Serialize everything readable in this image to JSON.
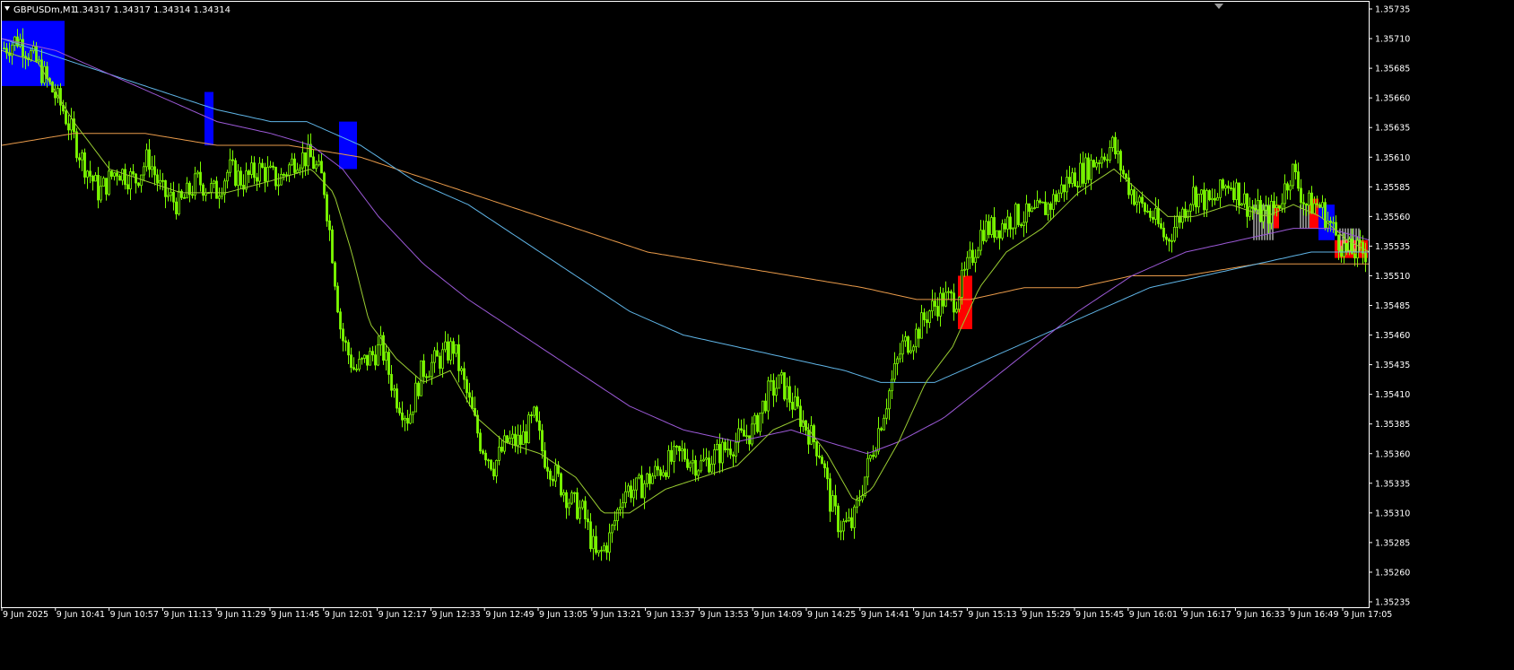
{
  "header": {
    "symbol_timeframe": "GBPUSDm,M1",
    "ohlc": "1.34317 1.34317 1.34314 1.34314",
    "menu_icon": "triangle-down-icon",
    "shift_marker_icon": "triangle-down-icon"
  },
  "colors": {
    "background": "#000000",
    "frame": "#ffffff",
    "candle": "#7cfc00",
    "ma_fast": "#9acd32",
    "ma_purple": "#9b59d6",
    "ma_blue": "#5fb4e6",
    "ma_orange": "#e89a4a",
    "band_blue": "#0000ff",
    "band_red": "#ff0000",
    "band_white": "#ffffff"
  },
  "chart_data": {
    "type": "candlestick",
    "y_ticks": [
      "1.35735",
      "1.35710",
      "1.35685",
      "1.35660",
      "1.35635",
      "1.35610",
      "1.35585",
      "1.35560",
      "1.35535",
      "1.35510",
      "1.35485",
      "1.35460",
      "1.35435",
      "1.35410",
      "1.35385",
      "1.35360",
      "1.35335",
      "1.35310",
      "1.35285",
      "1.35260",
      "1.35235"
    ],
    "x_ticks": [
      "9 Jun 2025",
      "9 Jun 10:41",
      "9 Jun 10:57",
      "9 Jun 11:13",
      "9 Jun 11:29",
      "9 Jun 11:45",
      "9 Jun 12:01",
      "9 Jun 12:17",
      "9 Jun 12:33",
      "9 Jun 12:49",
      "9 Jun 13:05",
      "9 Jun 13:21",
      "9 Jun 13:37",
      "9 Jun 13:53",
      "9 Jun 14:09",
      "9 Jun 14:25",
      "9 Jun 14:41",
      "9 Jun 14:57",
      "9 Jun 15:13",
      "9 Jun 15:29",
      "9 Jun 15:45",
      "9 Jun 16:01",
      "9 Jun 16:17",
      "9 Jun 16:33",
      "9 Jun 16:49",
      "9 Jun 17:05"
    ],
    "ylim": [
      1.3523,
      1.3574
    ],
    "price_path": [
      [
        0,
        1.357
      ],
      [
        20,
        1.3571
      ],
      [
        40,
        1.3569
      ],
      [
        55,
        1.3567
      ],
      [
        70,
        1.3565
      ],
      [
        90,
        1.3561
      ],
      [
        110,
        1.3558
      ],
      [
        130,
        1.356
      ],
      [
        150,
        1.3559
      ],
      [
        165,
        1.3561
      ],
      [
        180,
        1.3558
      ],
      [
        200,
        1.3557
      ],
      [
        220,
        1.3559
      ],
      [
        240,
        1.3558
      ],
      [
        255,
        1.356
      ],
      [
        270,
        1.3559
      ],
      [
        290,
        1.356
      ],
      [
        310,
        1.3559
      ],
      [
        330,
        1.3561
      ],
      [
        345,
        1.3561
      ],
      [
        360,
        1.3559
      ],
      [
        370,
        1.3553
      ],
      [
        380,
        1.3546
      ],
      [
        395,
        1.3543
      ],
      [
        410,
        1.3544
      ],
      [
        425,
        1.3545
      ],
      [
        440,
        1.3541
      ],
      [
        455,
        1.3539
      ],
      [
        470,
        1.3543
      ],
      [
        490,
        1.3544
      ],
      [
        505,
        1.3545
      ],
      [
        520,
        1.3541
      ],
      [
        535,
        1.3537
      ],
      [
        550,
        1.3535
      ],
      [
        565,
        1.3537
      ],
      [
        580,
        1.3537
      ],
      [
        595,
        1.3539
      ],
      [
        605,
        1.3536
      ],
      [
        620,
        1.3534
      ],
      [
        635,
        1.3532
      ],
      [
        650,
        1.3531
      ],
      [
        665,
        1.3527
      ],
      [
        680,
        1.3529
      ],
      [
        695,
        1.3533
      ],
      [
        710,
        1.3533
      ],
      [
        725,
        1.3534
      ],
      [
        740,
        1.3535
      ],
      [
        760,
        1.3536
      ],
      [
        780,
        1.3535
      ],
      [
        800,
        1.3536
      ],
      [
        820,
        1.3537
      ],
      [
        840,
        1.3538
      ],
      [
        855,
        1.3541
      ],
      [
        870,
        1.3542
      ],
      [
        885,
        1.354
      ],
      [
        900,
        1.3538
      ],
      [
        915,
        1.3536
      ],
      [
        925,
        1.3532
      ],
      [
        935,
        1.353
      ],
      [
        950,
        1.353
      ],
      [
        960,
        1.3533
      ],
      [
        975,
        1.3537
      ],
      [
        990,
        1.3541
      ],
      [
        1005,
        1.3545
      ],
      [
        1020,
        1.3546
      ],
      [
        1035,
        1.3548
      ],
      [
        1050,
        1.3549
      ],
      [
        1065,
        1.3549
      ],
      [
        1080,
        1.3552
      ],
      [
        1095,
        1.3555
      ],
      [
        1110,
        1.3555
      ],
      [
        1130,
        1.3556
      ],
      [
        1150,
        1.3556
      ],
      [
        1170,
        1.3557
      ],
      [
        1190,
        1.3559
      ],
      [
        1210,
        1.356
      ],
      [
        1225,
        1.3561
      ],
      [
        1240,
        1.3562
      ],
      [
        1255,
        1.3559
      ],
      [
        1270,
        1.3557
      ],
      [
        1285,
        1.3556
      ],
      [
        1300,
        1.3554
      ],
      [
        1315,
        1.3556
      ],
      [
        1330,
        1.3558
      ],
      [
        1350,
        1.3557
      ],
      [
        1370,
        1.3559
      ],
      [
        1390,
        1.3557
      ],
      [
        1410,
        1.3556
      ],
      [
        1425,
        1.3557
      ],
      [
        1440,
        1.356
      ],
      [
        1455,
        1.3557
      ],
      [
        1470,
        1.3557
      ],
      [
        1485,
        1.3555
      ],
      [
        1500,
        1.3553
      ],
      [
        1515,
        1.3553
      ],
      [
        1525,
        1.3553
      ]
    ],
    "ma_fast": [
      [
        0,
        1.357
      ],
      [
        40,
        1.3569
      ],
      [
        80,
        1.3564
      ],
      [
        120,
        1.356
      ],
      [
        160,
        1.3559
      ],
      [
        200,
        1.3558
      ],
      [
        250,
        1.3558
      ],
      [
        300,
        1.3559
      ],
      [
        345,
        1.356
      ],
      [
        370,
        1.3558
      ],
      [
        390,
        1.3553
      ],
      [
        410,
        1.3547
      ],
      [
        440,
        1.3544
      ],
      [
        470,
        1.3542
      ],
      [
        500,
        1.3543
      ],
      [
        530,
        1.3539
      ],
      [
        560,
        1.3537
      ],
      [
        600,
        1.3536
      ],
      [
        640,
        1.3534
      ],
      [
        670,
        1.3531
      ],
      [
        700,
        1.3531
      ],
      [
        740,
        1.3533
      ],
      [
        780,
        1.3534
      ],
      [
        820,
        1.3535
      ],
      [
        860,
        1.3538
      ],
      [
        890,
        1.3539
      ],
      [
        920,
        1.3536
      ],
      [
        950,
        1.3532
      ],
      [
        970,
        1.3533
      ],
      [
        1000,
        1.3537
      ],
      [
        1030,
        1.3542
      ],
      [
        1060,
        1.3545
      ],
      [
        1090,
        1.355
      ],
      [
        1120,
        1.3553
      ],
      [
        1160,
        1.3555
      ],
      [
        1200,
        1.3558
      ],
      [
        1240,
        1.356
      ],
      [
        1270,
        1.3558
      ],
      [
        1300,
        1.3556
      ],
      [
        1330,
        1.3556
      ],
      [
        1370,
        1.3557
      ],
      [
        1410,
        1.3556
      ],
      [
        1440,
        1.3557
      ],
      [
        1470,
        1.3556
      ],
      [
        1500,
        1.3554
      ],
      [
        1525,
        1.3553
      ]
    ],
    "ma_purple": [
      [
        0,
        1.3571
      ],
      [
        60,
        1.357
      ],
      [
        120,
        1.3568
      ],
      [
        180,
        1.3566
      ],
      [
        240,
        1.3564
      ],
      [
        300,
        1.3563
      ],
      [
        345,
        1.3562
      ],
      [
        380,
        1.356
      ],
      [
        420,
        1.3556
      ],
      [
        470,
        1.3552
      ],
      [
        520,
        1.3549
      ],
      [
        580,
        1.3546
      ],
      [
        640,
        1.3543
      ],
      [
        700,
        1.354
      ],
      [
        760,
        1.3538
      ],
      [
        820,
        1.3537
      ],
      [
        880,
        1.3538
      ],
      [
        920,
        1.3537
      ],
      [
        965,
        1.3536
      ],
      [
        1000,
        1.3537
      ],
      [
        1050,
        1.3539
      ],
      [
        1100,
        1.3542
      ],
      [
        1150,
        1.3545
      ],
      [
        1200,
        1.3548
      ],
      [
        1260,
        1.3551
      ],
      [
        1320,
        1.3553
      ],
      [
        1380,
        1.3554
      ],
      [
        1440,
        1.3555
      ],
      [
        1480,
        1.3555
      ],
      [
        1525,
        1.3554
      ]
    ],
    "ma_blue": [
      [
        0,
        1.3571
      ],
      [
        80,
        1.3569
      ],
      [
        160,
        1.3567
      ],
      [
        240,
        1.3565
      ],
      [
        300,
        1.3564
      ],
      [
        340,
        1.3564
      ],
      [
        370,
        1.3563
      ],
      [
        400,
        1.3562
      ],
      [
        460,
        1.3559
      ],
      [
        520,
        1.3557
      ],
      [
        580,
        1.3554
      ],
      [
        640,
        1.3551
      ],
      [
        700,
        1.3548
      ],
      [
        760,
        1.3546
      ],
      [
        820,
        1.3545
      ],
      [
        880,
        1.3544
      ],
      [
        940,
        1.3543
      ],
      [
        980,
        1.3542
      ],
      [
        1040,
        1.3542
      ],
      [
        1100,
        1.3544
      ],
      [
        1160,
        1.3546
      ],
      [
        1220,
        1.3548
      ],
      [
        1280,
        1.355
      ],
      [
        1340,
        1.3551
      ],
      [
        1400,
        1.3552
      ],
      [
        1460,
        1.3553
      ],
      [
        1525,
        1.3553
      ]
    ],
    "ma_orange": [
      [
        0,
        1.3562
      ],
      [
        80,
        1.3563
      ],
      [
        160,
        1.3563
      ],
      [
        240,
        1.3562
      ],
      [
        320,
        1.3562
      ],
      [
        400,
        1.3561
      ],
      [
        480,
        1.3559
      ],
      [
        560,
        1.3557
      ],
      [
        640,
        1.3555
      ],
      [
        720,
        1.3553
      ],
      [
        800,
        1.3552
      ],
      [
        880,
        1.3551
      ],
      [
        960,
        1.355
      ],
      [
        1020,
        1.3549
      ],
      [
        1080,
        1.3549
      ],
      [
        1140,
        1.355
      ],
      [
        1200,
        1.355
      ],
      [
        1260,
        1.3551
      ],
      [
        1320,
        1.3551
      ],
      [
        1400,
        1.3552
      ],
      [
        1460,
        1.3552
      ],
      [
        1525,
        1.3552
      ]
    ],
    "bands": [
      {
        "color": "blue",
        "x1": 2,
        "x2": 72,
        "top": 1.35725,
        "bottom": 1.3567
      },
      {
        "color": "blue",
        "x1": 228,
        "x2": 238,
        "top": 1.35665,
        "bottom": 1.3562
      },
      {
        "color": "blue",
        "x1": 378,
        "x2": 398,
        "top": 1.3564,
        "bottom": 1.356
      },
      {
        "color": "red",
        "x1": 1068,
        "x2": 1084,
        "top": 1.3551,
        "bottom": 1.35465
      },
      {
        "color": "white",
        "x1": 1398,
        "x2": 1420,
        "top": 1.3557,
        "bottom": 1.3554
      },
      {
        "color": "red",
        "x1": 1420,
        "x2": 1426,
        "top": 1.3557,
        "bottom": 1.3555
      },
      {
        "color": "white",
        "x1": 1450,
        "x2": 1460,
        "top": 1.3557,
        "bottom": 1.3555
      },
      {
        "color": "red",
        "x1": 1460,
        "x2": 1470,
        "top": 1.35575,
        "bottom": 1.3555
      },
      {
        "color": "blue",
        "x1": 1470,
        "x2": 1488,
        "top": 1.3557,
        "bottom": 1.3554
      },
      {
        "color": "red",
        "x1": 1488,
        "x2": 1525,
        "top": 1.3554,
        "bottom": 1.35525
      },
      {
        "color": "white",
        "x1": 1494,
        "x2": 1516,
        "top": 1.3555,
        "bottom": 1.3553
      }
    ]
  }
}
